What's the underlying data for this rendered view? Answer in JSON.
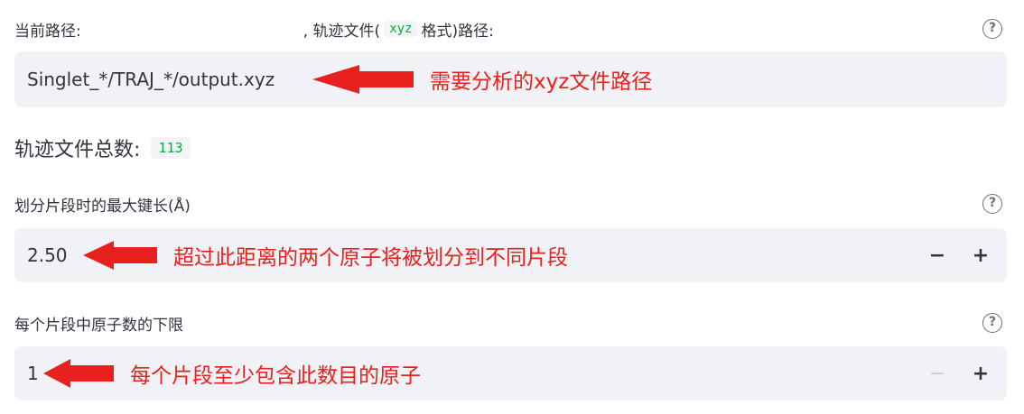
{
  "path_field": {
    "label_prefix": "当前路径:",
    "label_mid": ", 轨迹文件(",
    "label_code": "xyz",
    "label_suffix": "格式)路径:",
    "value": "Singlet_*/TRAJ_*/output.xyz",
    "annotation": "需要分析的xyz文件路径"
  },
  "total": {
    "label": "轨迹文件总数:",
    "value": "113"
  },
  "bond_length": {
    "label": "划分片段时的最大键长(Å)",
    "value": "2.50",
    "annotation": "超过此距离的两个原子将被划分到不同片段",
    "minus": "−",
    "plus": "+"
  },
  "min_atoms": {
    "label": "每个片段中原子数的下限",
    "value": "1",
    "annotation": "每个片段至少包含此数目的原子",
    "minus": "−",
    "plus": "+"
  },
  "help_glyph": "?",
  "colors": {
    "annotation_red": "#e8211f",
    "field_bg": "#f0f2f6",
    "code_green": "#09ab3b"
  },
  "icons": [
    "help-icon",
    "red-arrow-icon",
    "minus-icon",
    "plus-icon"
  ]
}
